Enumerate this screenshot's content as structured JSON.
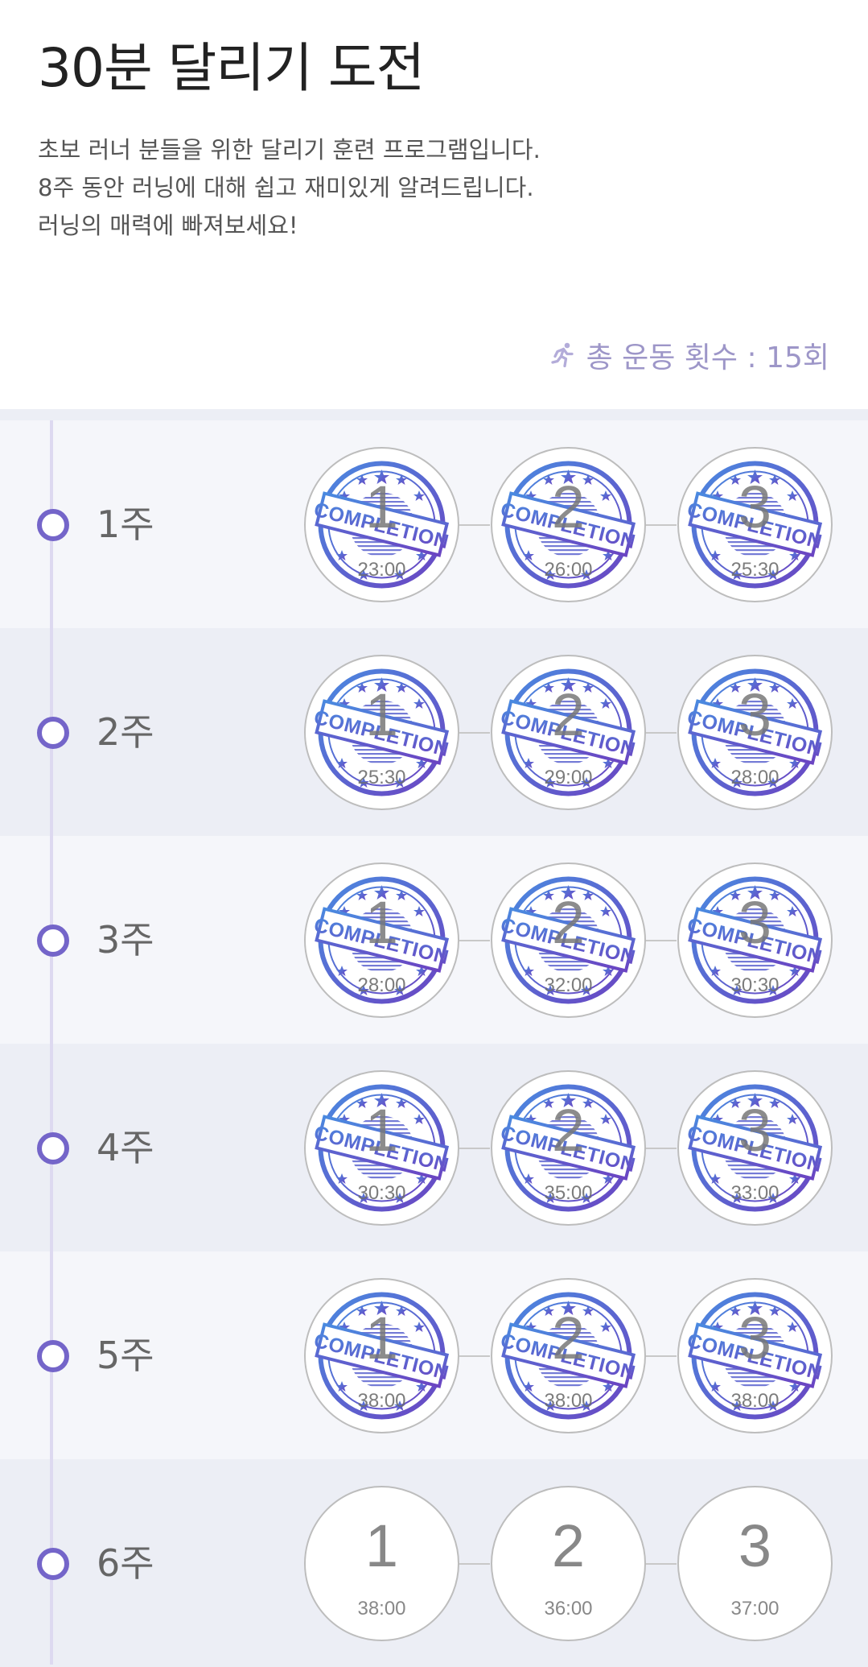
{
  "header": {
    "title": "30분 달리기 도전",
    "description": [
      "초보 러너 분들을 위한 달리기 훈련 프로그램입니다.",
      "8주 동안 러닝에 대해 쉽고 재미있게 알려드립니다.",
      "러닝의 매력에 빠져보세요!"
    ],
    "total_icon": "runner-icon",
    "total_label": "총 운동 횟수 : 15회"
  },
  "colors": {
    "accent": "#7465c9",
    "stamp_blue": "#3f6fd6",
    "stamp_purple": "#6a4fc4",
    "row_light": "#f5f6fa",
    "row_dark": "#eceef5"
  },
  "stamp_text": "COMPLETION",
  "weeks": [
    {
      "label": "1주",
      "sessions": [
        {
          "num": "1",
          "time": "23:00",
          "completed": true
        },
        {
          "num": "2",
          "time": "26:00",
          "completed": true
        },
        {
          "num": "3",
          "time": "25:30",
          "completed": true
        }
      ]
    },
    {
      "label": "2주",
      "sessions": [
        {
          "num": "1",
          "time": "25:30",
          "completed": true
        },
        {
          "num": "2",
          "time": "29:00",
          "completed": true
        },
        {
          "num": "3",
          "time": "28:00",
          "completed": true
        }
      ]
    },
    {
      "label": "3주",
      "sessions": [
        {
          "num": "1",
          "time": "28:00",
          "completed": true
        },
        {
          "num": "2",
          "time": "32:00",
          "completed": true
        },
        {
          "num": "3",
          "time": "30:30",
          "completed": true
        }
      ]
    },
    {
      "label": "4주",
      "sessions": [
        {
          "num": "1",
          "time": "30:30",
          "completed": true
        },
        {
          "num": "2",
          "time": "35:00",
          "completed": true
        },
        {
          "num": "3",
          "time": "33:00",
          "completed": true
        }
      ]
    },
    {
      "label": "5주",
      "sessions": [
        {
          "num": "1",
          "time": "38:00",
          "completed": true
        },
        {
          "num": "2",
          "time": "38:00",
          "completed": true
        },
        {
          "num": "3",
          "time": "38:00",
          "completed": true
        }
      ]
    },
    {
      "label": "6주",
      "sessions": [
        {
          "num": "1",
          "time": "38:00",
          "completed": false
        },
        {
          "num": "2",
          "time": "36:00",
          "completed": false
        },
        {
          "num": "3",
          "time": "37:00",
          "completed": false
        }
      ]
    }
  ]
}
